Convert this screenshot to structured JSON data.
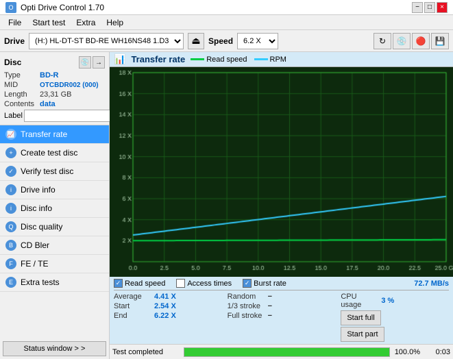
{
  "titlebar": {
    "title": "Opti Drive Control 1.70",
    "minimize": "−",
    "maximize": "□",
    "close": "×"
  },
  "menu": {
    "items": [
      "File",
      "Start test",
      "Extra",
      "Help"
    ]
  },
  "drivebar": {
    "drive_label": "Drive",
    "drive_value": "(H:)  HL-DT-ST BD-RE  WH16NS48 1.D3",
    "speed_label": "Speed",
    "speed_value": "6.2 X"
  },
  "disc": {
    "title": "Disc",
    "type_label": "Type",
    "type_value": "BD-R",
    "mid_label": "MID",
    "mid_value": "OTCBDR002 (000)",
    "length_label": "Length",
    "length_value": "23,31 GB",
    "contents_label": "Contents",
    "contents_value": "data",
    "label_label": "Label"
  },
  "nav": {
    "items": [
      {
        "id": "transfer-rate",
        "label": "Transfer rate",
        "active": true
      },
      {
        "id": "create-test-disc",
        "label": "Create test disc",
        "active": false
      },
      {
        "id": "verify-test-disc",
        "label": "Verify test disc",
        "active": false
      },
      {
        "id": "drive-info",
        "label": "Drive info",
        "active": false
      },
      {
        "id": "disc-info",
        "label": "Disc info",
        "active": false
      },
      {
        "id": "disc-quality",
        "label": "Disc quality",
        "active": false
      },
      {
        "id": "cd-bler",
        "label": "CD Bler",
        "active": false
      },
      {
        "id": "fe-te",
        "label": "FE / TE",
        "active": false
      },
      {
        "id": "extra-tests",
        "label": "Extra tests",
        "active": false
      }
    ],
    "status_window": "Status window > >"
  },
  "chart": {
    "title": "Transfer rate",
    "legend": {
      "read_speed_label": "Read speed",
      "rpm_label": "RPM",
      "read_speed_color": "#00cc44",
      "rpm_color": "#33ccff"
    },
    "y_labels": [
      "18 X",
      "16 X",
      "14 X",
      "12 X",
      "10 X",
      "8 X",
      "6 X",
      "4 X",
      "2 X"
    ],
    "x_labels": [
      "0.0",
      "2.5",
      "5.0",
      "7.5",
      "10.0",
      "12.5",
      "15.0",
      "17.5",
      "20.0",
      "22.5",
      "25.0 GB"
    ]
  },
  "checkboxes": {
    "read_speed": {
      "label": "Read speed",
      "checked": true
    },
    "access_times": {
      "label": "Access times",
      "checked": false
    },
    "burst_rate": {
      "label": "Burst rate",
      "checked": true
    },
    "burst_rate_value": "72.7 MB/s"
  },
  "stats": {
    "average_label": "Average",
    "average_value": "4.41 X",
    "random_label": "Random",
    "random_value": "−",
    "cpu_label": "CPU usage",
    "cpu_value": "3 %",
    "start_label": "Start",
    "start_value": "2.54 X",
    "stroke_1_3_label": "1/3 stroke",
    "stroke_1_3_value": "−",
    "end_label": "End",
    "end_value": "6.22 X",
    "full_stroke_label": "Full stroke",
    "full_stroke_value": "−",
    "start_full_btn": "Start full",
    "start_part_btn": "Start part"
  },
  "statusbar": {
    "text": "Test completed",
    "progress": 100,
    "progress_pct": "100.0%",
    "time": "0:03"
  }
}
